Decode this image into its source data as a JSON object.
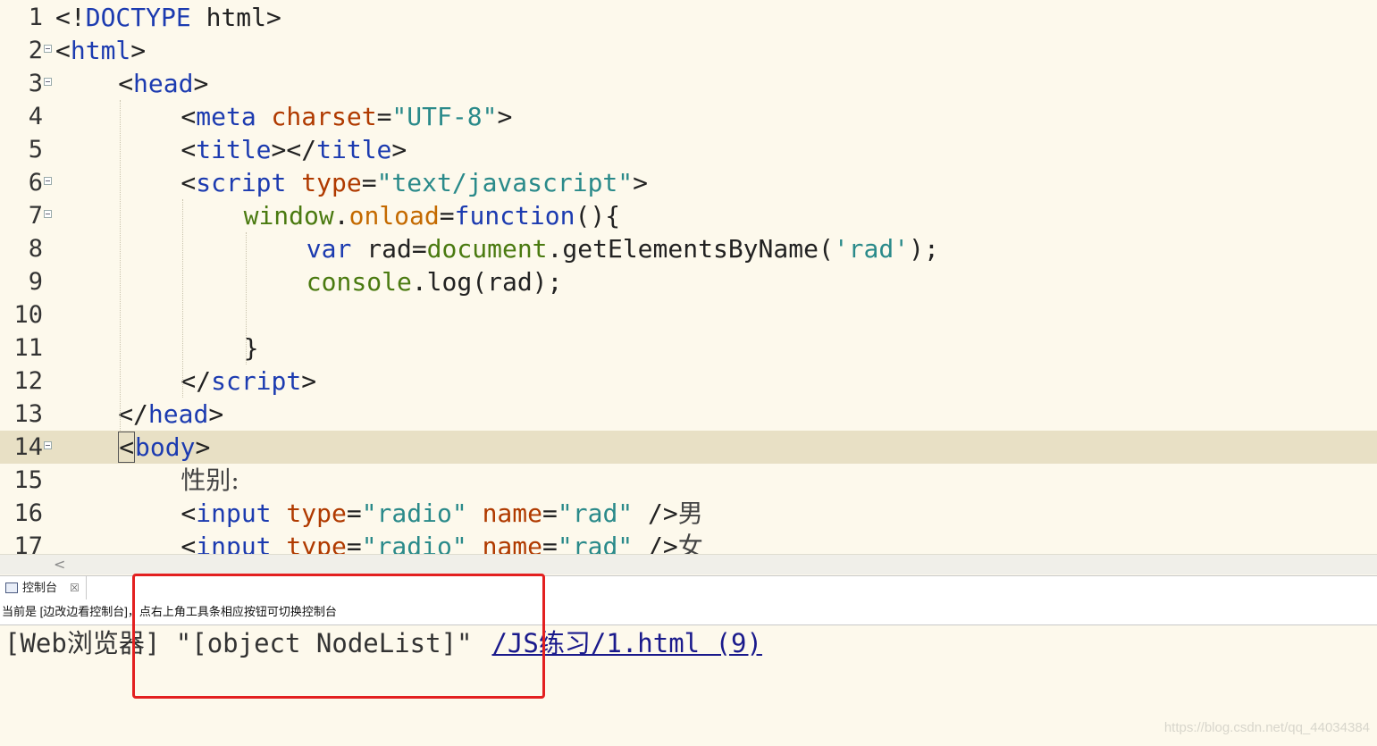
{
  "editor": {
    "lines": [
      {
        "n": "1",
        "indent": 0,
        "fold": false,
        "tokens": [
          {
            "t": "<!",
            "c": "t-br"
          },
          {
            "t": "DOCTYPE",
            "c": "t-dt"
          },
          {
            "t": " html>",
            "c": "t-br"
          }
        ]
      },
      {
        "n": "2",
        "indent": 0,
        "fold": true,
        "tokens": [
          {
            "t": "<",
            "c": "t-br"
          },
          {
            "t": "html",
            "c": "t-tag"
          },
          {
            "t": ">",
            "c": "t-br"
          }
        ]
      },
      {
        "n": "3",
        "indent": 1,
        "fold": true,
        "tokens": [
          {
            "t": "<",
            "c": "t-br"
          },
          {
            "t": "head",
            "c": "t-tag"
          },
          {
            "t": ">",
            "c": "t-br"
          }
        ]
      },
      {
        "n": "4",
        "indent": 2,
        "fold": false,
        "tokens": [
          {
            "t": "<",
            "c": "t-br"
          },
          {
            "t": "meta",
            "c": "t-tag"
          },
          {
            "t": " ",
            "c": ""
          },
          {
            "t": "charset",
            "c": "t-attr"
          },
          {
            "t": "=",
            "c": "t-br"
          },
          {
            "t": "\"UTF-8\"",
            "c": "t-str"
          },
          {
            "t": ">",
            "c": "t-br"
          }
        ]
      },
      {
        "n": "5",
        "indent": 2,
        "fold": false,
        "tokens": [
          {
            "t": "<",
            "c": "t-br"
          },
          {
            "t": "title",
            "c": "t-tag"
          },
          {
            "t": "></",
            "c": "t-br"
          },
          {
            "t": "title",
            "c": "t-tag"
          },
          {
            "t": ">",
            "c": "t-br"
          }
        ]
      },
      {
        "n": "6",
        "indent": 2,
        "fold": true,
        "tokens": [
          {
            "t": "<",
            "c": "t-br"
          },
          {
            "t": "script",
            "c": "t-tag"
          },
          {
            "t": " ",
            "c": ""
          },
          {
            "t": "type",
            "c": "t-attr"
          },
          {
            "t": "=",
            "c": "t-br"
          },
          {
            "t": "\"text/javascript\"",
            "c": "t-str"
          },
          {
            "t": ">",
            "c": "t-br"
          }
        ]
      },
      {
        "n": "7",
        "indent": 3,
        "fold": true,
        "tokens": [
          {
            "t": "window",
            "c": "t-js-obj"
          },
          {
            "t": ".",
            "c": "t-br"
          },
          {
            "t": "onload",
            "c": "t-js-prop"
          },
          {
            "t": "=",
            "c": "t-br"
          },
          {
            "t": "function",
            "c": "t-kw"
          },
          {
            "t": "(){",
            "c": "t-br"
          }
        ]
      },
      {
        "n": "8",
        "indent": 4,
        "fold": false,
        "tokens": [
          {
            "t": "var",
            "c": "t-kw"
          },
          {
            "t": " rad",
            "c": "t-br"
          },
          {
            "t": "=",
            "c": "t-br"
          },
          {
            "t": "document",
            "c": "t-cn"
          },
          {
            "t": ".getElementsByName(",
            "c": "t-br"
          },
          {
            "t": "'rad'",
            "c": "t-str"
          },
          {
            "t": ");",
            "c": "t-br"
          }
        ]
      },
      {
        "n": "9",
        "indent": 4,
        "fold": false,
        "tokens": [
          {
            "t": "console",
            "c": "t-cn"
          },
          {
            "t": ".log(rad);",
            "c": "t-br"
          }
        ]
      },
      {
        "n": "10",
        "indent": 0,
        "fold": false,
        "tokens": []
      },
      {
        "n": "11",
        "indent": 3,
        "fold": false,
        "tokens": [
          {
            "t": "}",
            "c": "t-br"
          }
        ]
      },
      {
        "n": "12",
        "indent": 2,
        "fold": false,
        "tokens": [
          {
            "t": "</",
            "c": "t-br"
          },
          {
            "t": "script",
            "c": "t-tag"
          },
          {
            "t": ">",
            "c": "t-br"
          }
        ]
      },
      {
        "n": "13",
        "indent": 1,
        "fold": false,
        "tokens": [
          {
            "t": "</",
            "c": "t-br"
          },
          {
            "t": "head",
            "c": "t-tag"
          },
          {
            "t": ">",
            "c": "t-br"
          }
        ]
      },
      {
        "n": "14",
        "indent": 1,
        "fold": true,
        "current": true,
        "tokens": [
          {
            "t": "<",
            "c": "t-br caret-box"
          },
          {
            "t": "body",
            "c": "t-tag"
          },
          {
            "t": ">",
            "c": "t-br"
          }
        ]
      },
      {
        "n": "15",
        "indent": 2,
        "fold": false,
        "tokens": [
          {
            "t": "性别:",
            "c": "t-cjk"
          }
        ]
      },
      {
        "n": "16",
        "indent": 2,
        "fold": false,
        "tokens": [
          {
            "t": "<",
            "c": "t-br"
          },
          {
            "t": "input",
            "c": "t-tag"
          },
          {
            "t": " ",
            "c": ""
          },
          {
            "t": "type",
            "c": "t-attr"
          },
          {
            "t": "=",
            "c": "t-br"
          },
          {
            "t": "\"radio\"",
            "c": "t-str"
          },
          {
            "t": " ",
            "c": ""
          },
          {
            "t": "name",
            "c": "t-attr"
          },
          {
            "t": "=",
            "c": "t-br"
          },
          {
            "t": "\"rad\"",
            "c": "t-str"
          },
          {
            "t": " />",
            "c": "t-br"
          },
          {
            "t": "男",
            "c": "t-cjk"
          }
        ]
      },
      {
        "n": "17",
        "indent": 2,
        "fold": false,
        "tokens": [
          {
            "t": "<",
            "c": "t-br"
          },
          {
            "t": "input",
            "c": "t-tag"
          },
          {
            "t": " ",
            "c": ""
          },
          {
            "t": "type",
            "c": "t-attr"
          },
          {
            "t": "=",
            "c": "t-br"
          },
          {
            "t": "\"radio\"",
            "c": "t-str"
          },
          {
            "t": " ",
            "c": ""
          },
          {
            "t": "name",
            "c": "t-attr"
          },
          {
            "t": "=",
            "c": "t-br"
          },
          {
            "t": "\"rad\"",
            "c": "t-str"
          },
          {
            "t": " />",
            "c": "t-br"
          },
          {
            "t": "女",
            "c": "t-cjk"
          }
        ]
      }
    ]
  },
  "scrollbar": {
    "left_arrow": "<"
  },
  "console": {
    "tab_label": "控制台",
    "tab_close": "☒",
    "info": "当前是 [边改边看控制台]，点右上角工具条相应按钮可切换控制台",
    "output": {
      "prefix": "[Web",
      "prefix_cjk": "浏览器",
      "message": "] \"[object NodeList]\"",
      "source_link": "/JS练习/1.html (9)"
    }
  },
  "watermark": "https://blog.csdn.net/qq_44034384",
  "colors": {
    "highlight_box": "#e32020",
    "editor_bg": "#fdf9ec",
    "current_line": "#e8e0c5"
  }
}
